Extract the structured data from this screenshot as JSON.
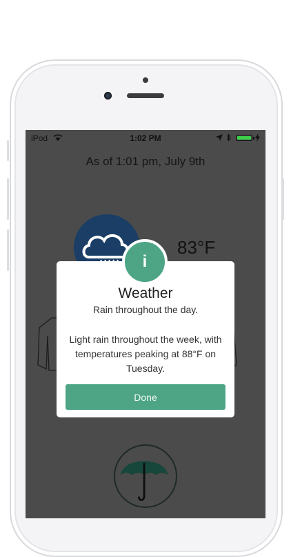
{
  "status_bar": {
    "carrier": "iPod",
    "time": "1:02 PM",
    "battery_level": 1.0,
    "icons": [
      "wifi-icon",
      "location-arrow-icon",
      "bluetooth-icon",
      "battery-icon",
      "charging-bolt-icon"
    ]
  },
  "weather": {
    "as_of": "As of 1:01 pm, July 9th",
    "temperature": "83°F",
    "condition_icon": "rain-cloud-icon",
    "suggestion_icons": [
      "jacket-icon",
      "umbrella-icon"
    ]
  },
  "dialog": {
    "badge_glyph": "i",
    "title": "Weather",
    "subtitle": "Rain throughout the day.",
    "body": "Light rain throughout the week, with temperatures peaking at 88°F on Tuesday.",
    "done_label": "Done"
  },
  "colors": {
    "accent": "#4da586",
    "overlay": "#4b4b4b",
    "cloud_circle": "#1a3e66",
    "battery": "#3bd14b"
  }
}
